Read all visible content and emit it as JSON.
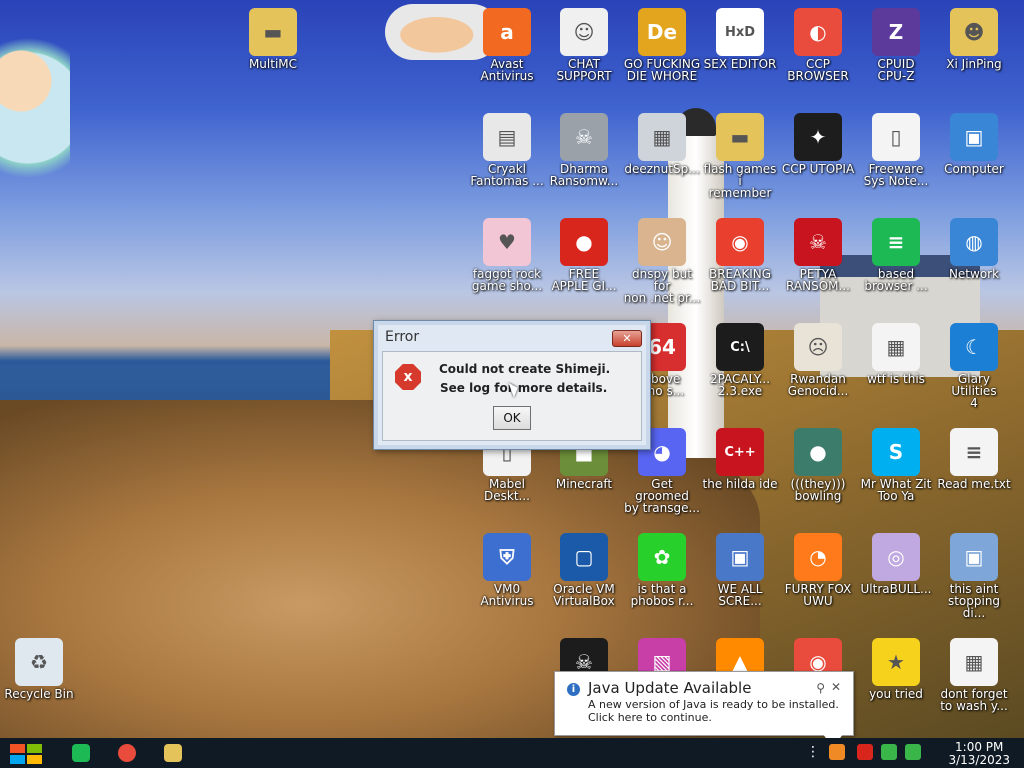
{
  "desktop_icons": [
    {
      "label": "MultiMC",
      "color": "#e5c35b",
      "glyph": "folder-icon"
    },
    {
      "label": "Avast\nAntivirus",
      "color": "#f26a21",
      "glyph": "avast-icon"
    },
    {
      "label": "CHAT\nSUPPORT",
      "color": "#f0f0f0",
      "glyph": "doctor-icon"
    },
    {
      "label": "GO FUCKING\nDIE WHORE",
      "color": "#e3a51e",
      "glyph": "de-icon"
    },
    {
      "label": "SEX EDITOR",
      "color": "#ffffff",
      "glyph": "hxd-icon"
    },
    {
      "label": "CCP\nBROWSER",
      "color": "#e94b3c",
      "glyph": "browser-icon"
    },
    {
      "label": "CPUID\nCPU-Z",
      "color": "#5b3a9b",
      "glyph": "cpuz-icon"
    },
    {
      "label": "Xi JinPing",
      "color": "#e5c35b",
      "glyph": "user-folder-icon"
    },
    {
      "label": "Cryakl\nFantomas ...",
      "color": "#e8e8e8",
      "glyph": "window-icon"
    },
    {
      "label": "Dharma\nRansomw...",
      "color": "#9aa1a9",
      "glyph": "skull-icon"
    },
    {
      "label": "deeznutSp...",
      "color": "#cfd4da",
      "glyph": "stack-icon"
    },
    {
      "label": "flash games i\nremember",
      "color": "#e5c35b",
      "glyph": "folder-icon"
    },
    {
      "label": "CCP UTOPIA",
      "color": "#1d1d1d",
      "glyph": "dragon-icon"
    },
    {
      "label": "Freeware\nSys Note...",
      "color": "#f4f4f4",
      "glyph": "document-icon"
    },
    {
      "label": "Computer",
      "color": "#3a86d6",
      "glyph": "computer-icon"
    },
    {
      "label": "faggot rock\ngame sho...",
      "color": "#f2c6d4",
      "glyph": "pig-icon"
    },
    {
      "label": "FREE\nAPPLE GI...",
      "color": "#d9261c",
      "glyph": "apple-icon"
    },
    {
      "label": "dnspy but for\nnon .net pr...",
      "color": "#d9b48f",
      "glyph": "portrait-icon"
    },
    {
      "label": "BREAKING\nBAD BIT...",
      "color": "#e83f2f",
      "glyph": "angry-bird-icon"
    },
    {
      "label": "PETYA\nRANSOM...",
      "color": "#c8141e",
      "glyph": "skull-icon"
    },
    {
      "label": "based\nbrowser ...",
      "color": "#1db954",
      "glyph": "spotify-icon"
    },
    {
      "label": "Network",
      "color": "#3a86d6",
      "glyph": "network-icon"
    },
    {
      "label": "above\n: no s...",
      "color": "#d72f2f",
      "glyph": "64-icon"
    },
    {
      "label": "2PACALY...\n2.3.exe",
      "color": "#1c1c1c",
      "glyph": "terminal-icon"
    },
    {
      "label": "Rwandan\nGenocid...",
      "color": "#e9e2d6",
      "glyph": "meme-icon"
    },
    {
      "label": "wtf is this",
      "color": "#f4f4f4",
      "glyph": "calendar-icon"
    },
    {
      "label": "Glary Utilities\n4",
      "color": "#1c7fd6",
      "glyph": "moon-icon"
    },
    {
      "label": "Mabel\nDeskt...",
      "color": "#f2f2f2",
      "glyph": "document-icon"
    },
    {
      "label": "Minecraft",
      "color": "#6b8e3a",
      "glyph": "minecraft-icon"
    },
    {
      "label": "Get groomed\nby transge...",
      "color": "#5865f2",
      "glyph": "discord-icon"
    },
    {
      "label": "the hilda ide",
      "color": "#c8141e",
      "glyph": "devcpp-icon"
    },
    {
      "label": "(((they)))\nbowling",
      "color": "#3b7d6a",
      "glyph": "bowling-icon"
    },
    {
      "label": "Mr What Zit\nToo Ya",
      "color": "#00aff0",
      "glyph": "skype-icon"
    },
    {
      "label": "Read me.txt",
      "color": "#f4f4f4",
      "glyph": "text-file-icon"
    },
    {
      "label": "VM0\nAntivirus",
      "color": "#3d6fd0",
      "glyph": "shield-icon"
    },
    {
      "label": "Oracle VM\nVirtualBox",
      "color": "#1a5aa8",
      "glyph": "virtualbox-icon"
    },
    {
      "label": "is that a\nphobos r...",
      "color": "#27d02a",
      "glyph": "icq-icon"
    },
    {
      "label": "WE ALL\nSCRE...",
      "color": "#4a78c9",
      "glyph": "computer-icon"
    },
    {
      "label": "FURRY FOX\nUWU",
      "color": "#ff7a1a",
      "glyph": "firefox-icon"
    },
    {
      "label": "UltraBULL...",
      "color": "#c0a8e0",
      "glyph": "disc-icon"
    },
    {
      "label": "this aint\nstopping di...",
      "color": "#7ea6d8",
      "glyph": "computer-icon"
    },
    {
      "label": "Recycle Bin",
      "color": "#dfe7ef",
      "glyph": "recycle-bin-icon"
    },
    {
      "label": "",
      "color": "#1c1c1c",
      "glyph": "skull-icon"
    },
    {
      "label": "",
      "color": "#c83fa8",
      "glyph": "photo-icon"
    },
    {
      "label": "",
      "color": "#ff8a00",
      "glyph": "vlc-icon"
    },
    {
      "label": "",
      "color": "#e94b3c",
      "glyph": "chrome-icon"
    },
    {
      "label": "you tried",
      "color": "#f7d21c",
      "glyph": "star-icon"
    },
    {
      "label": "dont forget\nto wash y...",
      "color": "#f4f4f4",
      "glyph": "calendar-icon"
    }
  ],
  "error_dialog": {
    "title": "Error",
    "close_glyph": "✕",
    "icon_glyph": "x",
    "line1": "Could not create Shimeji.",
    "line2": "See log for more details.",
    "ok_label": "OK"
  },
  "java_toast": {
    "title": "Java Update Available",
    "line1": "A new version of Java is ready to be installed.",
    "line2": "Click here to continue.",
    "info_glyph": "i",
    "pin_glyph": "⚲",
    "close_glyph": "✕"
  },
  "taskbar": {
    "time": "1:00 PM",
    "date": "3/13/2023",
    "overflow_glyph": "⋮",
    "start_colors": [
      "#f35325",
      "#81bc06",
      "#05a6f0",
      "#ffba08"
    ],
    "pinned": [
      {
        "name": "spotify-taskbar-icon",
        "color": "#1db954"
      },
      {
        "name": "chrome-taskbar-icon",
        "color": "#e94b3c"
      },
      {
        "name": "explorer-taskbar-icon",
        "color": "#e5c35b"
      }
    ],
    "tray": [
      {
        "name": "java-tray-icon",
        "color": "#f08a24"
      },
      {
        "name": "flag-tray-icon",
        "color": "#d9261c"
      },
      {
        "name": "network-tray-icon",
        "color": "#3ab54a"
      },
      {
        "name": "volume-tray-icon",
        "color": "#3ab54a"
      }
    ]
  }
}
